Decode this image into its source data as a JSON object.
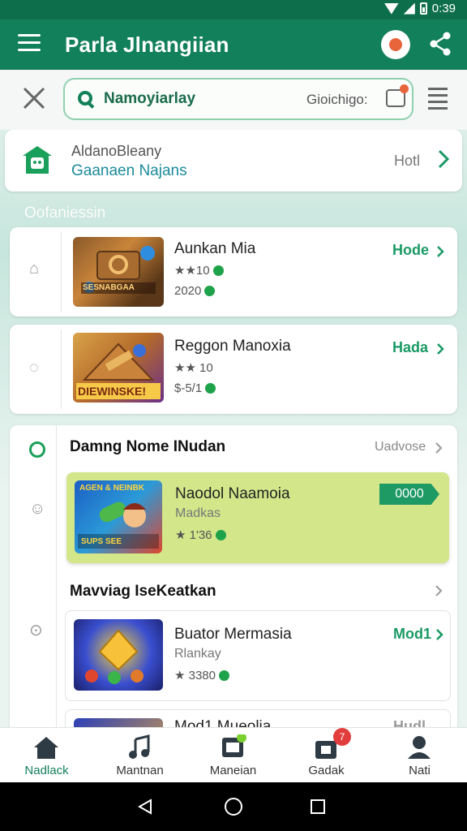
{
  "status_bar": {
    "time": "0:39"
  },
  "app_bar": {
    "title": "Parla Jlnangiian"
  },
  "search": {
    "query": "Namoyiarlay",
    "hint": "Gioichigo:"
  },
  "promo": {
    "line1": "AldanoBleany",
    "line2": "Gaanaen Najans",
    "action": "Hotl"
  },
  "section_caption": "Oofaniessin",
  "games": [
    {
      "title": "Aunkan Mia",
      "rating": "★★10",
      "sub": "2020",
      "action": "Hode",
      "thumb_text": "SESNABGAA"
    },
    {
      "title": "Reggon Manoxia",
      "rating": "★★ 10",
      "sub": "$-5/1",
      "action": "Hada",
      "thumb_text": "DIEWINSKE!"
    }
  ],
  "group": {
    "title": "Damng Nome INudan",
    "more": "Uadvose",
    "featured": {
      "title": "Naodol Naamoia",
      "sub": "Madkas",
      "rating": "★ 1'36",
      "price": "0000",
      "thumb_top": "AGEN & NEINBK",
      "thumb_bottom": "SUPS SEE"
    },
    "subsection_title": "Mavviag IseKeatkan",
    "sub_game": {
      "title": "Buator Mermasia",
      "sub": "Rlankay",
      "rating": "★ 3380",
      "action": "Mod1"
    },
    "partial_game": {
      "title": "Mod1 Mueolia",
      "action": "Hudl"
    }
  },
  "bottom_nav": [
    {
      "label": "Nadlack",
      "icon": "home-icon",
      "active": true
    },
    {
      "label": "Mantnan",
      "icon": "music-icon",
      "active": false
    },
    {
      "label": "Maneian",
      "icon": "library-icon",
      "active": false
    },
    {
      "label": "Gadak",
      "icon": "bag-icon",
      "active": false,
      "badge": "7"
    },
    {
      "label": "Nati",
      "icon": "profile-icon",
      "active": false
    }
  ],
  "colors": {
    "primary": "#12805a",
    "accent": "#1a9a64",
    "featured_bg": "#d3e68a",
    "badge": "#e23d3d"
  }
}
